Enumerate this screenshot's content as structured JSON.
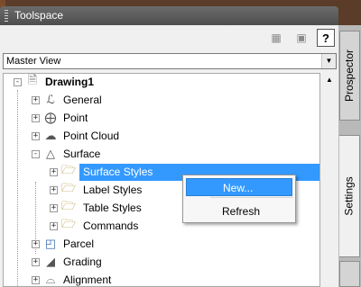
{
  "window": {
    "title": "Toolspace"
  },
  "toolbar": {
    "help_label": "?"
  },
  "view_selector": {
    "value": "Master View"
  },
  "tree": {
    "root": "Drawing1",
    "items": [
      {
        "label": "General"
      },
      {
        "label": "Point"
      },
      {
        "label": "Point Cloud"
      },
      {
        "label": "Surface"
      },
      {
        "label": "Surface Styles"
      },
      {
        "label": "Label Styles"
      },
      {
        "label": "Table Styles"
      },
      {
        "label": "Commands"
      },
      {
        "label": "Parcel"
      },
      {
        "label": "Grading"
      },
      {
        "label": "Alignment"
      }
    ]
  },
  "context_menu": {
    "items": [
      {
        "label": "New..."
      },
      {
        "label": "Refresh"
      }
    ]
  },
  "side_tabs": [
    {
      "label": "Prospector"
    },
    {
      "label": "Settings"
    }
  ]
}
